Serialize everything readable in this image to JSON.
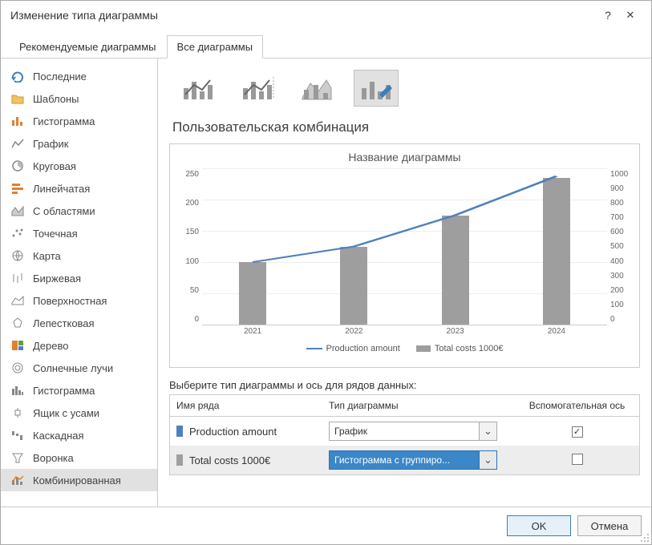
{
  "window": {
    "title": "Изменение типа диаграммы",
    "help_label": "?",
    "close_label": "✕"
  },
  "tabs": {
    "recommended": "Рекомендуемые диаграммы",
    "all": "Все диаграммы"
  },
  "sidebar": {
    "items": [
      {
        "label": "Последние",
        "icon": "recent"
      },
      {
        "label": "Шаблоны",
        "icon": "folder"
      },
      {
        "label": "Гистограмма",
        "icon": "column"
      },
      {
        "label": "График",
        "icon": "line"
      },
      {
        "label": "Круговая",
        "icon": "pie"
      },
      {
        "label": "Линейчатая",
        "icon": "bar"
      },
      {
        "label": "С областями",
        "icon": "area"
      },
      {
        "label": "Точечная",
        "icon": "scatter"
      },
      {
        "label": "Карта",
        "icon": "map"
      },
      {
        "label": "Биржевая",
        "icon": "stock"
      },
      {
        "label": "Поверхностная",
        "icon": "surface"
      },
      {
        "label": "Лепестковая",
        "icon": "radar"
      },
      {
        "label": "Дерево",
        "icon": "treemap"
      },
      {
        "label": "Солнечные лучи",
        "icon": "sunburst"
      },
      {
        "label": "Гистограмма",
        "icon": "histogram"
      },
      {
        "label": "Ящик с усами",
        "icon": "boxplot"
      },
      {
        "label": "Каскадная",
        "icon": "waterfall"
      },
      {
        "label": "Воронка",
        "icon": "funnel"
      },
      {
        "label": "Комбинированная",
        "icon": "combo"
      }
    ],
    "selected_index": 18
  },
  "section_title": "Пользовательская комбинация",
  "series_config": {
    "prompt": "Выберите тип диаграммы и ось для рядов данных:",
    "col_name": "Имя ряда",
    "col_type": "Тип диаграммы",
    "col_axis": "Вспомогательная ось",
    "rows": [
      {
        "name": "Production amount",
        "type": "График",
        "secondary": true,
        "color": "#4f81bd"
      },
      {
        "name": "Total costs 1000€",
        "type": "Гистограмма с группиро...",
        "secondary": false,
        "color": "#9e9e9e"
      }
    ]
  },
  "footer": {
    "ok": "OK",
    "cancel": "Отмена"
  },
  "chart_data": {
    "type": "combo",
    "title": "Название диаграммы",
    "categories": [
      "2021",
      "2022",
      "2023",
      "2024"
    ],
    "series": [
      {
        "name": "Production amount",
        "type": "line",
        "axis": "secondary",
        "values": [
          400,
          500,
          700,
          950
        ],
        "color": "#4f81bd"
      },
      {
        "name": "Total costs 1000€",
        "type": "bar",
        "axis": "primary",
        "values": [
          100,
          125,
          175,
          235
        ],
        "color": "#9e9e9e"
      }
    ],
    "y_primary": {
      "min": 0,
      "max": 250,
      "ticks": [
        250,
        200,
        150,
        100,
        50,
        0
      ]
    },
    "y_secondary": {
      "min": 0,
      "max": 1000,
      "ticks": [
        1000,
        900,
        800,
        700,
        600,
        500,
        400,
        300,
        200,
        100,
        0
      ]
    },
    "legend": [
      "Production amount",
      "Total costs 1000€"
    ]
  }
}
